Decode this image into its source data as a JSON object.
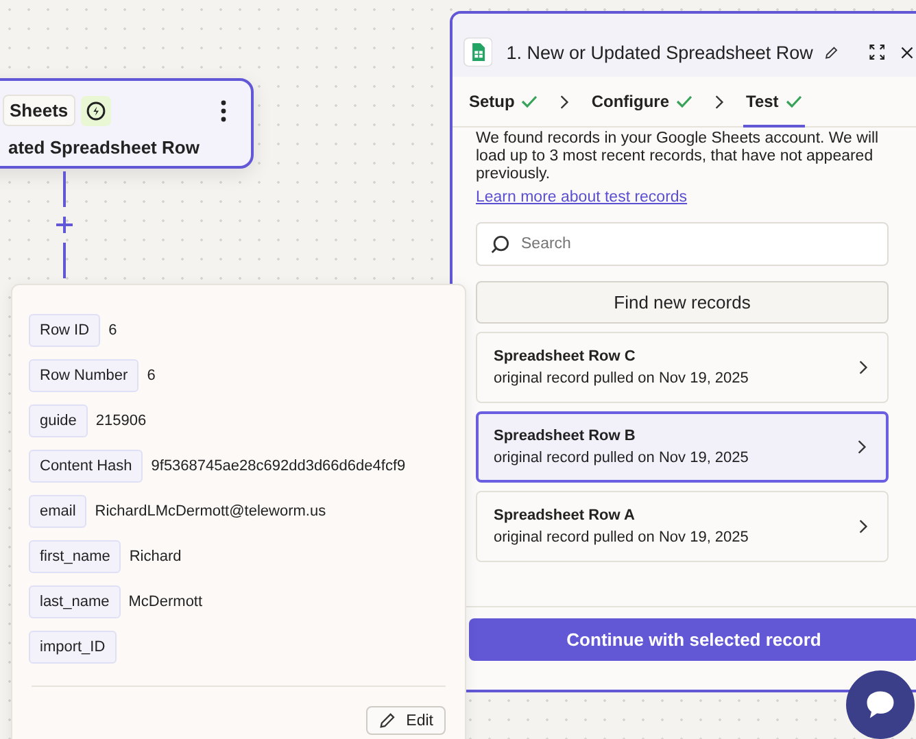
{
  "node": {
    "app_label": "Sheets",
    "title": "ated Spreadsheet Row"
  },
  "panel": {
    "title": "1. New or Updated Spreadsheet Row",
    "steps": [
      {
        "label": "Setup",
        "checked": true,
        "selected": false
      },
      {
        "label": "Configure",
        "checked": true,
        "selected": false
      },
      {
        "label": "Test",
        "checked": true,
        "selected": true
      }
    ],
    "intro": "We found records in your Google Sheets account. We will load up to 3 most recent records, that have not appeared previously.",
    "link": "Learn more about test records",
    "search": {
      "placeholder": "Search"
    },
    "find_button": "Find new records",
    "records": [
      {
        "title": "Spreadsheet Row C",
        "subtitle": "original record pulled on Nov 19, 2025",
        "selected": false
      },
      {
        "title": "Spreadsheet Row B",
        "subtitle": "original record pulled on Nov 19, 2025",
        "selected": true
      },
      {
        "title": "Spreadsheet Row A",
        "subtitle": "original record pulled on Nov 19, 2025",
        "selected": false
      }
    ],
    "continue_button": "Continue with selected record"
  },
  "record_details": {
    "fields": [
      {
        "key": "Row ID",
        "value": "6"
      },
      {
        "key": "Row Number",
        "value": "6"
      },
      {
        "key": "guide",
        "value": "215906"
      },
      {
        "key": "Content Hash",
        "value": "9f5368745ae28c692dd3d66d6de4fcf9"
      },
      {
        "key": "email",
        "value": "RichardLMcDermott@teleworm.us"
      },
      {
        "key": "first_name",
        "value": "Richard"
      },
      {
        "key": "last_name",
        "value": "McDermott"
      },
      {
        "key": "import_ID"
      }
    ],
    "edit_button": "Edit"
  }
}
